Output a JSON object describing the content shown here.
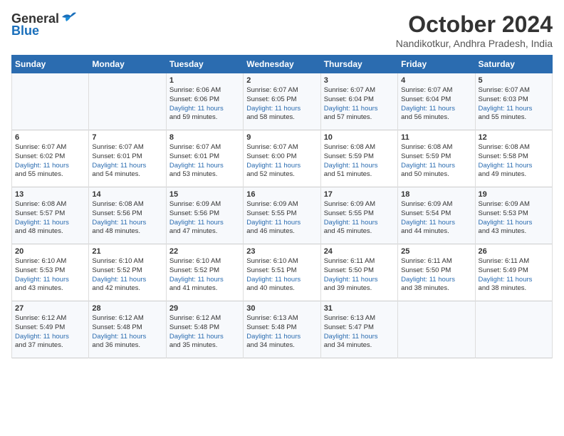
{
  "header": {
    "logo_general": "General",
    "logo_blue": "Blue",
    "month": "October 2024",
    "location": "Nandikotkur, Andhra Pradesh, India"
  },
  "weekdays": [
    "Sunday",
    "Monday",
    "Tuesday",
    "Wednesday",
    "Thursday",
    "Friday",
    "Saturday"
  ],
  "weeks": [
    [
      {
        "day": "",
        "content": ""
      },
      {
        "day": "",
        "content": ""
      },
      {
        "day": "1",
        "content": "Sunrise: 6:06 AM\nSunset: 6:06 PM\nDaylight: 11 hours\nand 59 minutes."
      },
      {
        "day": "2",
        "content": "Sunrise: 6:07 AM\nSunset: 6:05 PM\nDaylight: 11 hours\nand 58 minutes."
      },
      {
        "day": "3",
        "content": "Sunrise: 6:07 AM\nSunset: 6:04 PM\nDaylight: 11 hours\nand 57 minutes."
      },
      {
        "day": "4",
        "content": "Sunrise: 6:07 AM\nSunset: 6:04 PM\nDaylight: 11 hours\nand 56 minutes."
      },
      {
        "day": "5",
        "content": "Sunrise: 6:07 AM\nSunset: 6:03 PM\nDaylight: 11 hours\nand 55 minutes."
      }
    ],
    [
      {
        "day": "6",
        "content": "Sunrise: 6:07 AM\nSunset: 6:02 PM\nDaylight: 11 hours\nand 55 minutes."
      },
      {
        "day": "7",
        "content": "Sunrise: 6:07 AM\nSunset: 6:01 PM\nDaylight: 11 hours\nand 54 minutes."
      },
      {
        "day": "8",
        "content": "Sunrise: 6:07 AM\nSunset: 6:01 PM\nDaylight: 11 hours\nand 53 minutes."
      },
      {
        "day": "9",
        "content": "Sunrise: 6:07 AM\nSunset: 6:00 PM\nDaylight: 11 hours\nand 52 minutes."
      },
      {
        "day": "10",
        "content": "Sunrise: 6:08 AM\nSunset: 5:59 PM\nDaylight: 11 hours\nand 51 minutes."
      },
      {
        "day": "11",
        "content": "Sunrise: 6:08 AM\nSunset: 5:59 PM\nDaylight: 11 hours\nand 50 minutes."
      },
      {
        "day": "12",
        "content": "Sunrise: 6:08 AM\nSunset: 5:58 PM\nDaylight: 11 hours\nand 49 minutes."
      }
    ],
    [
      {
        "day": "13",
        "content": "Sunrise: 6:08 AM\nSunset: 5:57 PM\nDaylight: 11 hours\nand 48 minutes."
      },
      {
        "day": "14",
        "content": "Sunrise: 6:08 AM\nSunset: 5:56 PM\nDaylight: 11 hours\nand 48 minutes."
      },
      {
        "day": "15",
        "content": "Sunrise: 6:09 AM\nSunset: 5:56 PM\nDaylight: 11 hours\nand 47 minutes."
      },
      {
        "day": "16",
        "content": "Sunrise: 6:09 AM\nSunset: 5:55 PM\nDaylight: 11 hours\nand 46 minutes."
      },
      {
        "day": "17",
        "content": "Sunrise: 6:09 AM\nSunset: 5:55 PM\nDaylight: 11 hours\nand 45 minutes."
      },
      {
        "day": "18",
        "content": "Sunrise: 6:09 AM\nSunset: 5:54 PM\nDaylight: 11 hours\nand 44 minutes."
      },
      {
        "day": "19",
        "content": "Sunrise: 6:09 AM\nSunset: 5:53 PM\nDaylight: 11 hours\nand 43 minutes."
      }
    ],
    [
      {
        "day": "20",
        "content": "Sunrise: 6:10 AM\nSunset: 5:53 PM\nDaylight: 11 hours\nand 43 minutes."
      },
      {
        "day": "21",
        "content": "Sunrise: 6:10 AM\nSunset: 5:52 PM\nDaylight: 11 hours\nand 42 minutes."
      },
      {
        "day": "22",
        "content": "Sunrise: 6:10 AM\nSunset: 5:52 PM\nDaylight: 11 hours\nand 41 minutes."
      },
      {
        "day": "23",
        "content": "Sunrise: 6:10 AM\nSunset: 5:51 PM\nDaylight: 11 hours\nand 40 minutes."
      },
      {
        "day": "24",
        "content": "Sunrise: 6:11 AM\nSunset: 5:50 PM\nDaylight: 11 hours\nand 39 minutes."
      },
      {
        "day": "25",
        "content": "Sunrise: 6:11 AM\nSunset: 5:50 PM\nDaylight: 11 hours\nand 38 minutes."
      },
      {
        "day": "26",
        "content": "Sunrise: 6:11 AM\nSunset: 5:49 PM\nDaylight: 11 hours\nand 38 minutes."
      }
    ],
    [
      {
        "day": "27",
        "content": "Sunrise: 6:12 AM\nSunset: 5:49 PM\nDaylight: 11 hours\nand 37 minutes."
      },
      {
        "day": "28",
        "content": "Sunrise: 6:12 AM\nSunset: 5:48 PM\nDaylight: 11 hours\nand 36 minutes."
      },
      {
        "day": "29",
        "content": "Sunrise: 6:12 AM\nSunset: 5:48 PM\nDaylight: 11 hours\nand 35 minutes."
      },
      {
        "day": "30",
        "content": "Sunrise: 6:13 AM\nSunset: 5:48 PM\nDaylight: 11 hours\nand 34 minutes."
      },
      {
        "day": "31",
        "content": "Sunrise: 6:13 AM\nSunset: 5:47 PM\nDaylight: 11 hours\nand 34 minutes."
      },
      {
        "day": "",
        "content": ""
      },
      {
        "day": "",
        "content": ""
      }
    ]
  ]
}
